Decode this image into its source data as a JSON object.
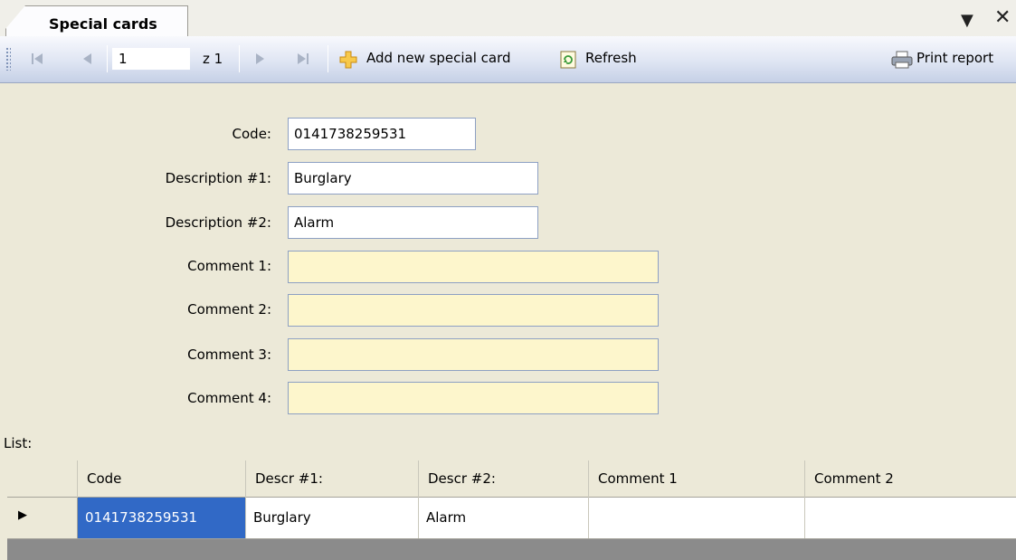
{
  "tab": {
    "title": "Special cards",
    "dropdown_icon": "pin-dropdown-icon",
    "close_icon": "close-icon"
  },
  "toolbar": {
    "page_value": "1",
    "page_of": "z 1",
    "add_label": "Add new special card",
    "refresh_label": "Refresh",
    "print_label": "Print report"
  },
  "form": {
    "code_label": "Code:",
    "code_value": "0141738259531",
    "desc1_label": "Description #1:",
    "desc1_value": "Burglary",
    "desc2_label": "Description #2:",
    "desc2_value": "Alarm",
    "comment1_label": "Comment 1:",
    "comment1_value": "",
    "comment2_label": "Comment 2:",
    "comment2_value": "",
    "comment3_label": "Comment 3:",
    "comment3_value": "",
    "comment4_label": "Comment 4:",
    "comment4_value": ""
  },
  "list": {
    "label": "List:",
    "columns": [
      "Code",
      "Descr #1:",
      "Descr #2:",
      "Comment 1",
      "Comment 2"
    ],
    "rows": [
      [
        "0141738259531",
        "Burglary",
        "Alarm",
        "",
        ""
      ]
    ]
  },
  "colors": {
    "selection": "#3169c6",
    "comment_bg": "#fdf6cc"
  }
}
